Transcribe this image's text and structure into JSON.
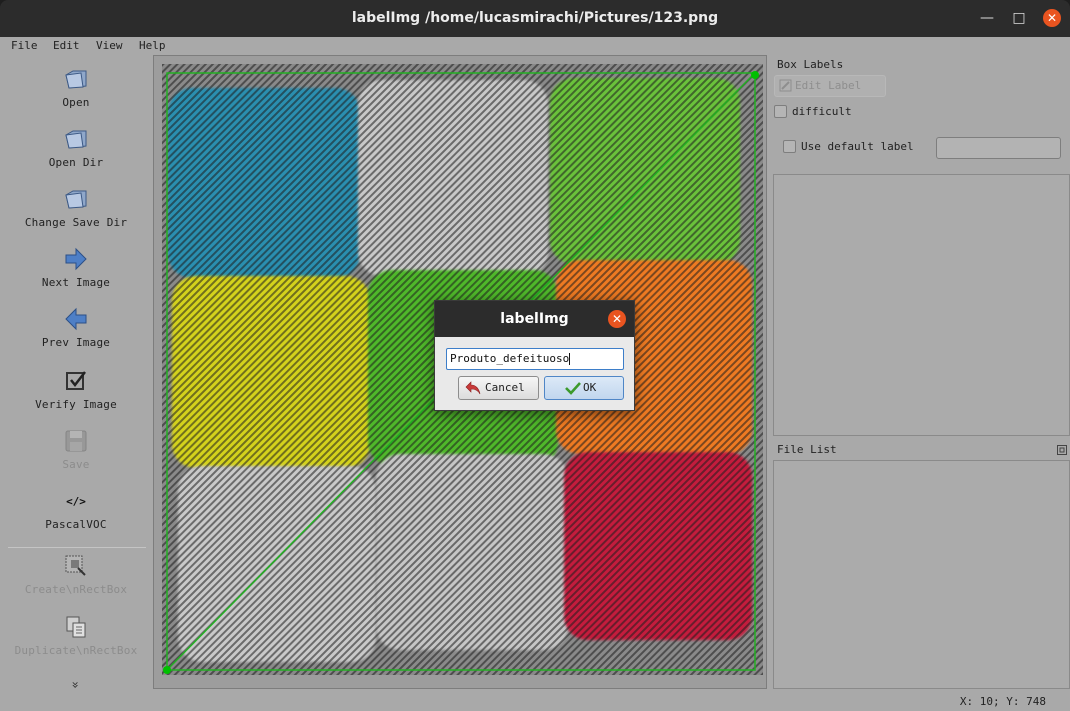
{
  "window": {
    "title": "labelImg /home/lucasmirachi/Pictures/123.png"
  },
  "menu": [
    {
      "label": "File"
    },
    {
      "label": "Edit"
    },
    {
      "label": "View"
    },
    {
      "label": "Help"
    }
  ],
  "toolbar": {
    "open": "Open",
    "open_dir": "Open Dir",
    "change_save_dir": "Change Save Dir",
    "next_image": "Next Image",
    "prev_image": "Prev Image",
    "verify_image": "Verify Image",
    "save": "Save",
    "format": "PascalVOC",
    "create_rect": "Create\\nRectBox",
    "duplicate_rect": "Duplicate\\nRectBox",
    "more": "»"
  },
  "box_labels": {
    "title": "Box Labels",
    "edit_label": "Edit Label",
    "difficult": "difficult",
    "use_default_label": "Use default label",
    "default_label_value": ""
  },
  "file_list": {
    "title": "File List"
  },
  "status": {
    "coords": "X: 10; Y: 748"
  },
  "dialog": {
    "title": "labelImg",
    "input_value": "Produto_defeituoso",
    "cancel": "Cancel",
    "ok": "OK"
  },
  "canvas": {
    "tiles": [
      {
        "color": "#2b8fb0"
      },
      {
        "color": "#c8c8c8"
      },
      {
        "color": "#6ac23a"
      },
      {
        "color": "#d4d21c"
      },
      {
        "color": "#4fb82c"
      },
      {
        "color": "#ee7a20"
      },
      {
        "color": "#c9c9c9"
      },
      {
        "color": "#c6c6c6"
      },
      {
        "color": "#c41e3c"
      }
    ],
    "shape_color": "#00c000"
  }
}
